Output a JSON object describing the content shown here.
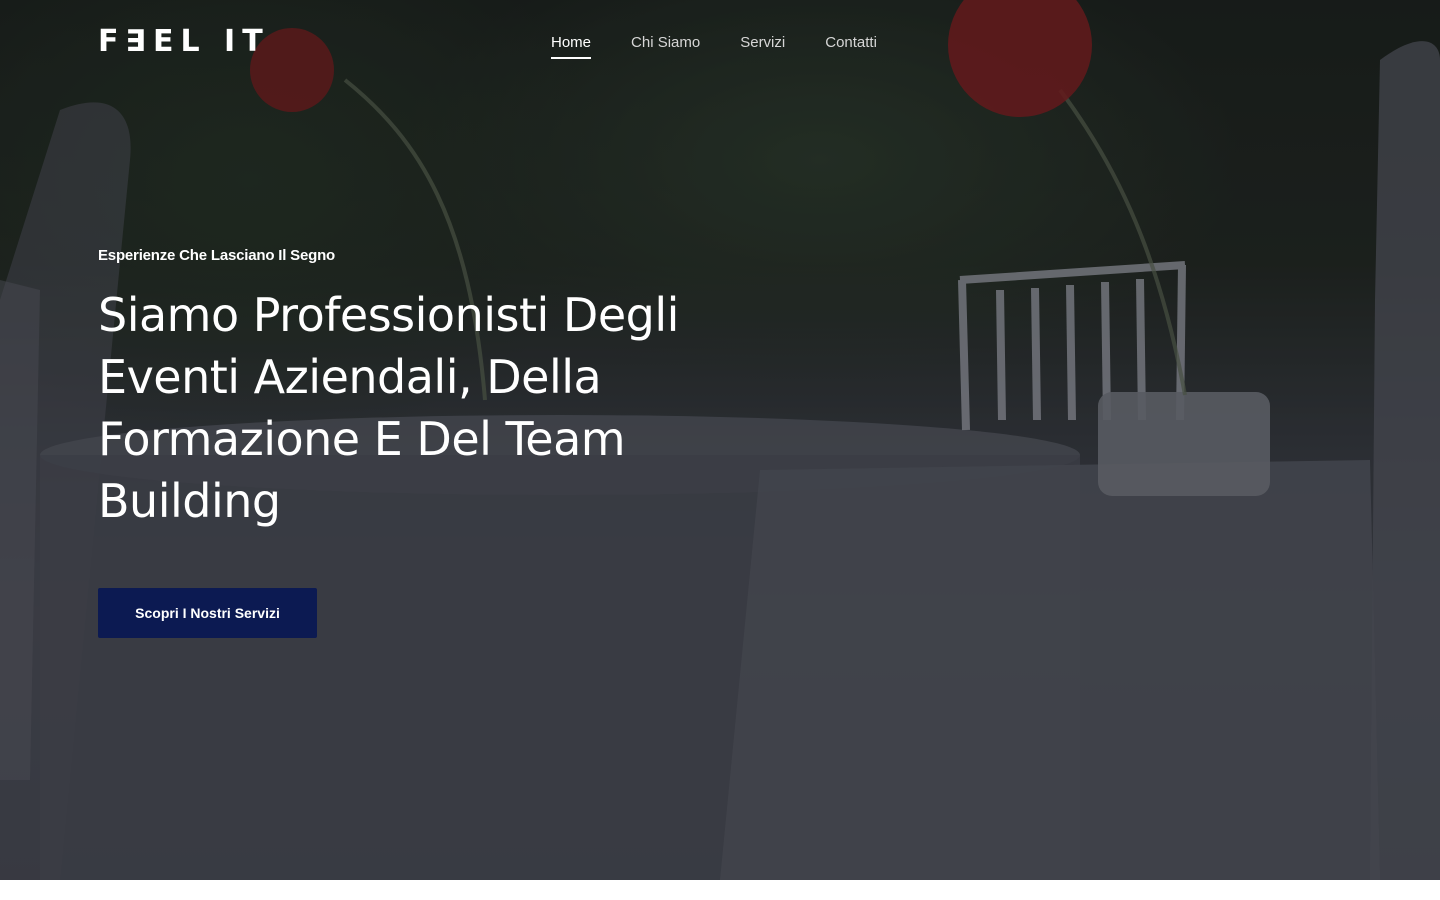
{
  "header": {
    "logo": "F∃EL IT",
    "nav": [
      {
        "label": "Home",
        "active": true
      },
      {
        "label": "Chi Siamo",
        "active": false
      },
      {
        "label": "Servizi",
        "active": false
      },
      {
        "label": "Contatti",
        "active": false
      }
    ]
  },
  "hero": {
    "eyebrow": "Esperienze Che Lasciano Il Segno",
    "headline": "Siamo Professionisti Degli Eventi Aziendali, Della Formazione E Del Team Building",
    "cta_label": "Scopri I Nostri Servizi"
  },
  "colors": {
    "cta_background": "#0c1a52",
    "text": "#ffffff",
    "flower": "#8a1a1a"
  }
}
